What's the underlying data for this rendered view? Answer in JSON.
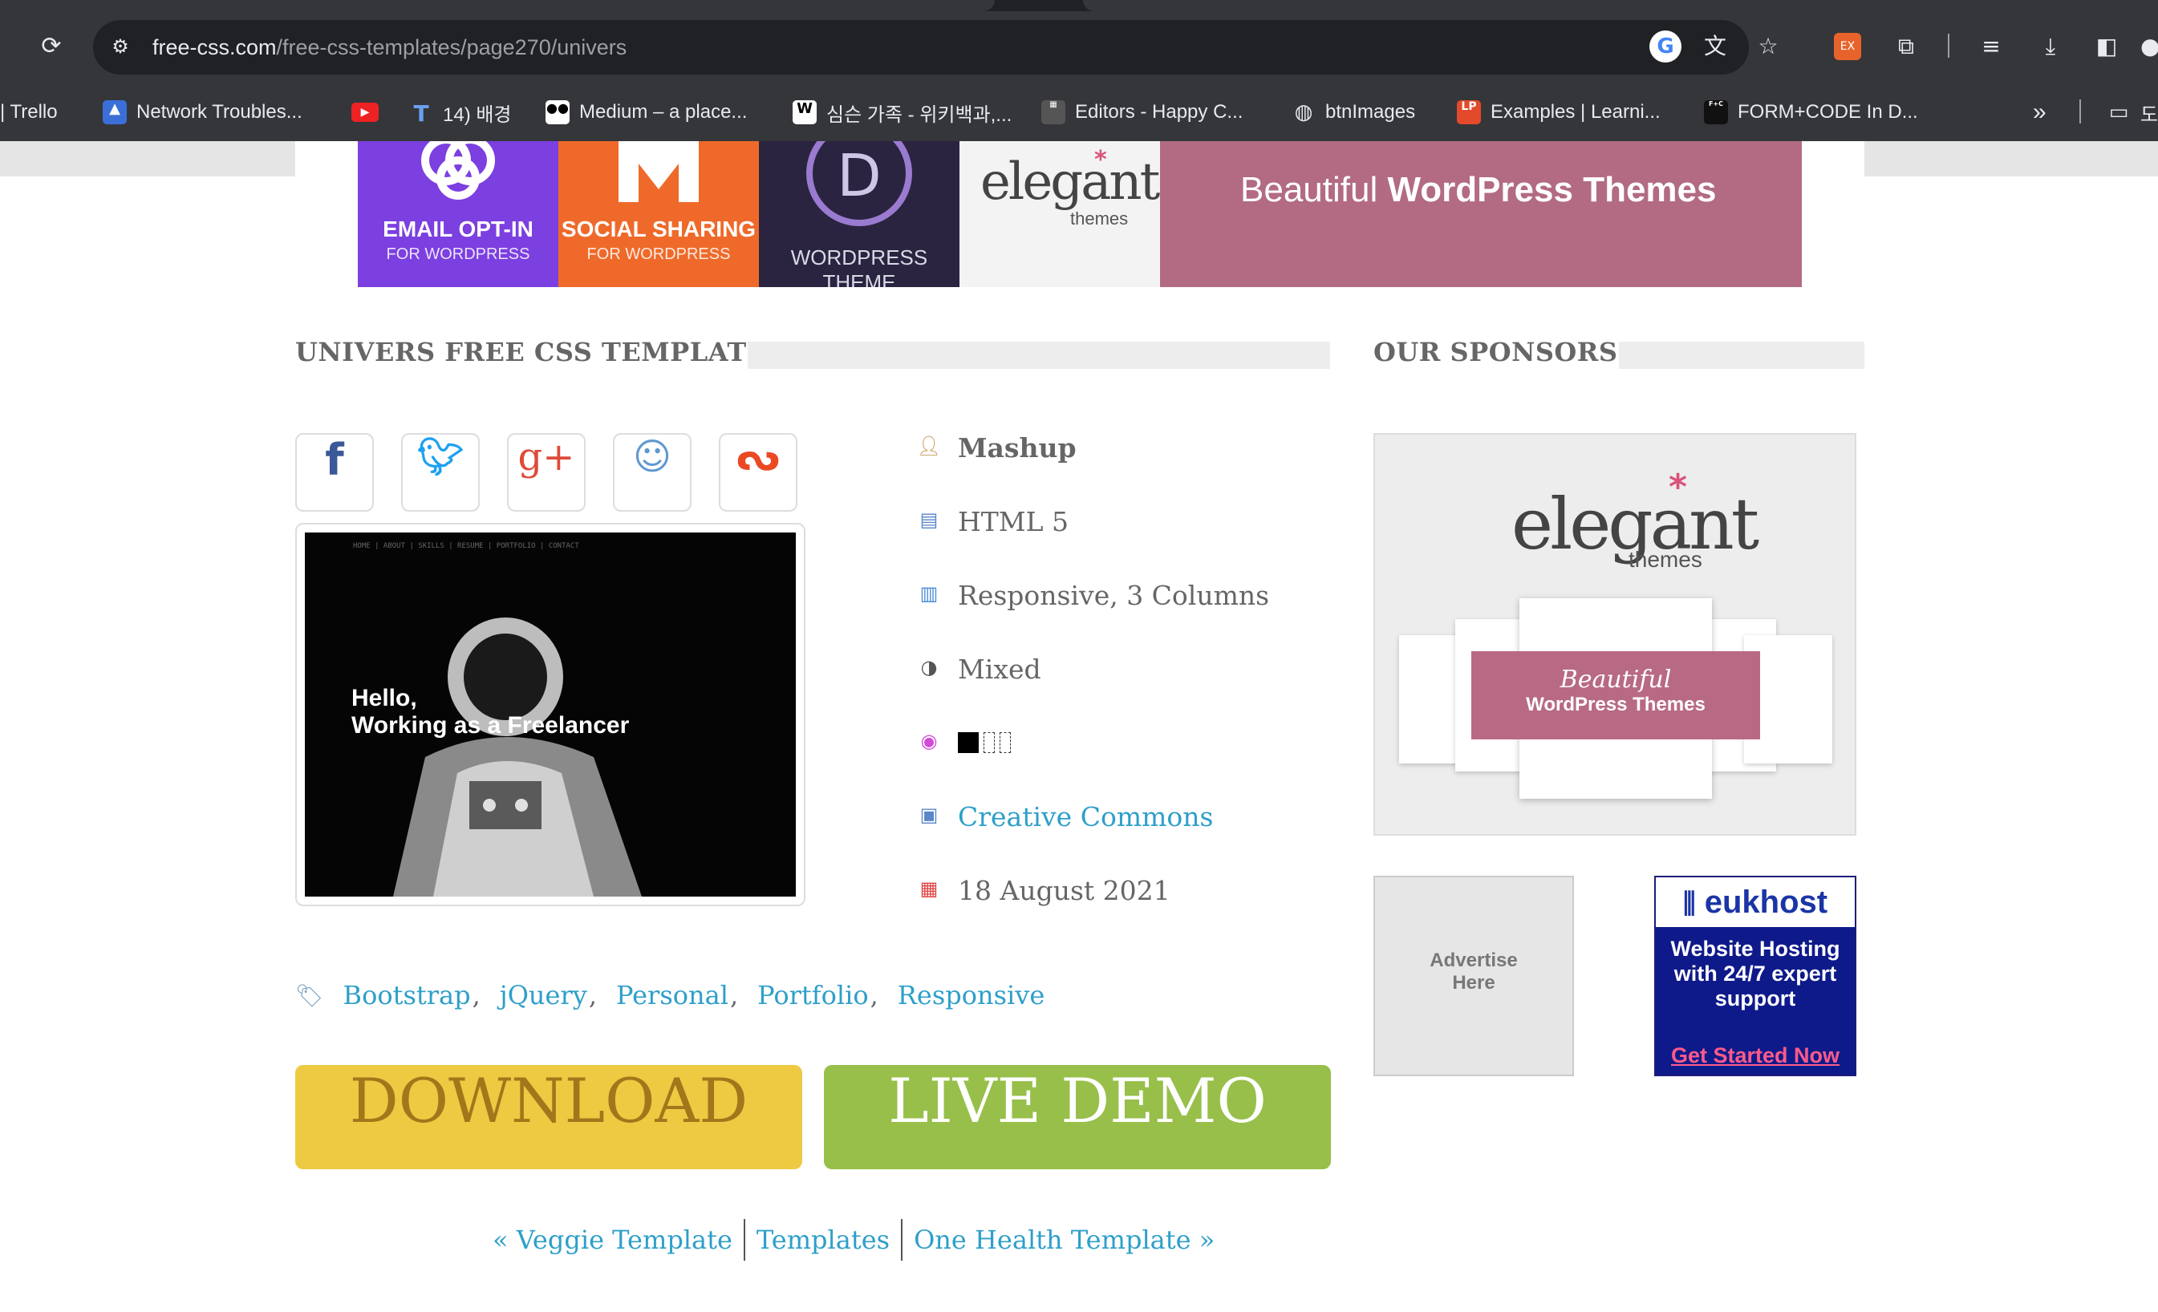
{
  "browser": {
    "url_host": "free-css.com",
    "url_path": "/free-css-templates/page270/univers",
    "bookmarks": [
      {
        "label": "| Trello"
      },
      {
        "label": "Network Troubles..."
      },
      {
        "label": ""
      },
      {
        "label": "14) 배경"
      },
      {
        "label": "Medium – a place..."
      },
      {
        "label": "심슨 가족 - 위키백과,..."
      },
      {
        "label": "Editors - Happy C..."
      },
      {
        "label": "btnImages"
      },
      {
        "label": "Examples | Learni..."
      },
      {
        "label": "FORM+CODE In D..."
      }
    ],
    "more_label": "»",
    "folder_label": "도"
  },
  "banner": {
    "tile1_title": "EMAIL OPT-IN",
    "tile1_sub": "FOR WORDPRESS",
    "tile2_title": "SOCIAL SHARING",
    "tile2_sub": "FOR WORDPRESS",
    "tile3_title": "WORDPRESS THEME",
    "tile3_letter": "D",
    "tile4_brand": "elegant",
    "tile4_sub": "themes",
    "tile5_light": "Beautiful ",
    "tile5_bold": "WordPress Themes"
  },
  "main": {
    "title": "UNIVERS FREE CSS TEMPLATE",
    "thumbnail": {
      "nav": "HOME  |  ABOUT  |  SKILLS  |  RESUME  |  PORTFOLIO  |  CONTACT",
      "hello_line1": "Hello,",
      "hello_line2": "Working as a Freelancer"
    },
    "meta": {
      "type": "Mashup",
      "html": "HTML 5",
      "layout": "Responsive, 3 Columns",
      "style": "Mixed",
      "license": "Creative Commons",
      "date": "18 August 2021"
    },
    "tags": [
      "Bootstrap",
      "jQuery",
      "Personal",
      "Portfolio",
      "Responsive"
    ],
    "download_label": "DOWNLOAD",
    "demo_label": "LIVE DEMO",
    "prev_label": "« Veggie Template",
    "index_label": "Templates",
    "next_label": "One Health Template »"
  },
  "sidebar": {
    "title": "OUR SPONSORS",
    "sponsor_brand": "elegant",
    "sponsor_sub": "themes",
    "sponsor_line1": "Beautiful",
    "sponsor_line2": "WordPress Themes",
    "advertise_line1": "Advertise",
    "advertise_line2": "Here",
    "euk_logo": "eukhost",
    "euk_body": "Website Hosting with 24/7 expert support",
    "euk_cta": "Get Started Now"
  },
  "colors": {
    "link": "#2e9fc9",
    "download_bg": "#eec942",
    "demo_bg": "#97bf4a",
    "banner_pink": "#b26b83"
  }
}
